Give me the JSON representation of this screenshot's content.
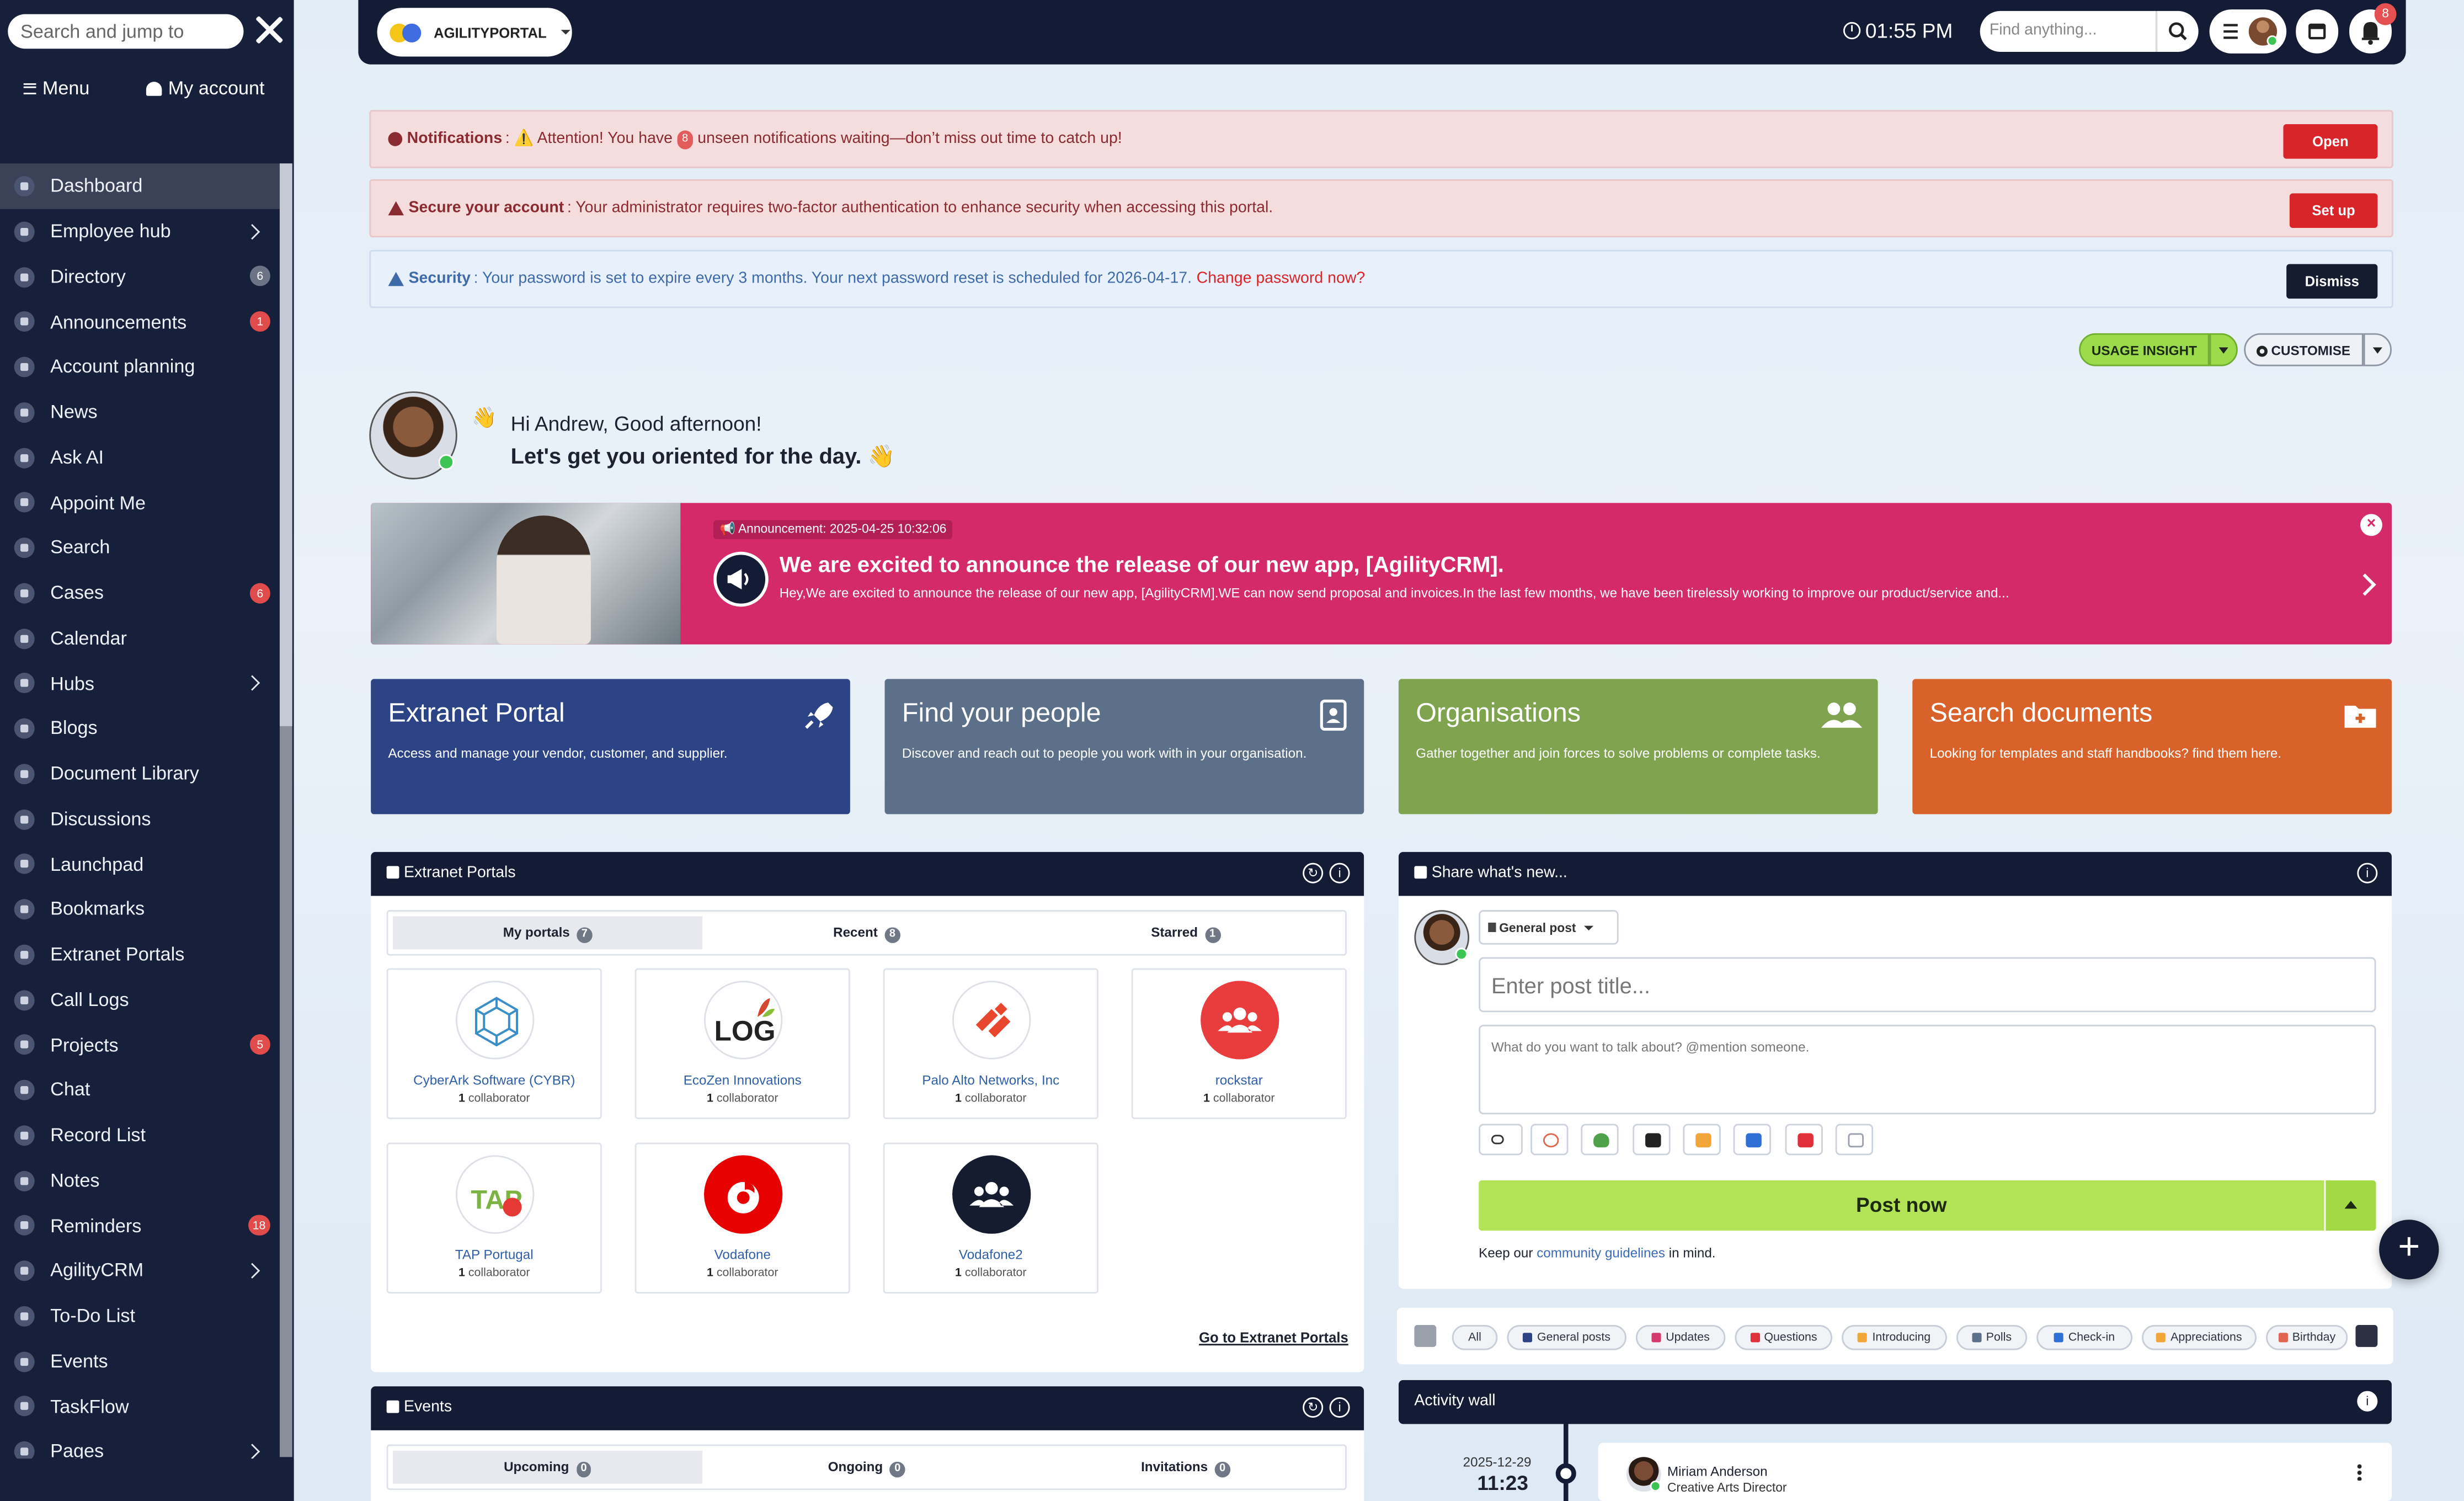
{
  "sidebar": {
    "search_placeholder": "Search and jump to",
    "menu_tab": "Menu",
    "account_tab": "My account",
    "items": [
      {
        "label": "Dashboard"
      },
      {
        "label": "Employee hub",
        "chevron": true
      },
      {
        "label": "Directory",
        "badge": "6",
        "badge_color": "gray"
      },
      {
        "label": "Announcements",
        "badge": "1",
        "badge_color": "red"
      },
      {
        "label": "Account planning"
      },
      {
        "label": "News"
      },
      {
        "label": "Ask AI"
      },
      {
        "label": "Appoint Me"
      },
      {
        "label": "Search"
      },
      {
        "label": "Cases",
        "badge": "6",
        "badge_color": "red"
      },
      {
        "label": "Calendar"
      },
      {
        "label": "Hubs",
        "chevron": true
      },
      {
        "label": "Blogs"
      },
      {
        "label": "Document Library"
      },
      {
        "label": "Discussions"
      },
      {
        "label": "Launchpad"
      },
      {
        "label": "Bookmarks"
      },
      {
        "label": "Extranet Portals"
      },
      {
        "label": "Call Logs"
      },
      {
        "label": "Projects",
        "badge": "5",
        "badge_color": "red"
      },
      {
        "label": "Chat"
      },
      {
        "label": "Record List"
      },
      {
        "label": "Notes"
      },
      {
        "label": "Reminders",
        "badge": "18",
        "badge_color": "red"
      },
      {
        "label": "AgilityCRM",
        "chevron": true
      },
      {
        "label": "To-Do List"
      },
      {
        "label": "Events"
      },
      {
        "label": "TaskFlow"
      },
      {
        "label": "Pages",
        "chevron": true
      }
    ]
  },
  "topbar": {
    "brand": "AGILITYPORTAL",
    "time": "01:55 PM",
    "find_placeholder": "Find anything...",
    "notification_count": "8"
  },
  "alerts": {
    "notifications": {
      "title": "Notifications",
      "text_a": ": ⚠️ Attention! You have",
      "count": "8",
      "text_b": "unseen notifications waiting—don’t miss out time to catch up!",
      "button": "Open"
    },
    "secure": {
      "title": "Secure your account",
      "text": ": Your administrator requires two-factor authentication to enhance security when accessing this portal.",
      "button": "Set up"
    },
    "security": {
      "title": "Security",
      "text": ": Your password is set to expire every 3 months. Your next password reset is scheduled for 2026-04-17.",
      "link": "Change password now?",
      "button": "Dismiss"
    }
  },
  "controls": {
    "usage": "USAGE INSIGHT",
    "customise": "CUSTOMISE"
  },
  "greeting": {
    "line1": "Hi Andrew, Good afternoon!",
    "line2": "Let's get you oriented for the day."
  },
  "announcement": {
    "tag": "Announcement: 2025-04-25 10:32:06",
    "title": "We are excited to announce the release of our new app, [AgilityCRM].",
    "body": "Hey,We are excited to announce the release of our new app, [AgilityCRM].WE can now send proposal and invoices.In the last few months, we have been tirelessly working to improve our product/service and..."
  },
  "tiles": [
    {
      "title": "Extranet Portal",
      "desc": "Access and manage your vendor, customer, and supplier.",
      "color": "#2c4486",
      "icon": "rocket-icon"
    },
    {
      "title": "Find your people",
      "desc": "Discover and reach out to people you work with in your organisation.",
      "color": "#5d7089",
      "icon": "contact-book-icon"
    },
    {
      "title": "Organisations",
      "desc": "Gather together and join forces to solve problems or complete tasks.",
      "color": "#7fa34f",
      "icon": "users-icon"
    },
    {
      "title": "Search documents",
      "desc": "Looking for templates and staff handbooks? find them here.",
      "color": "#d9622b",
      "icon": "folder-plus-icon"
    }
  ],
  "extranet": {
    "title": "Extranet Portals",
    "tabs": [
      {
        "label": "My portals",
        "count": "7"
      },
      {
        "label": "Recent",
        "count": "8"
      },
      {
        "label": "Starred",
        "count": "1"
      }
    ],
    "portals": [
      {
        "name": "CyberArk Software (CYBR)",
        "count": "1",
        "unit": "collaborator"
      },
      {
        "name": "EcoZen Innovations",
        "count": "1",
        "unit": "collaborator"
      },
      {
        "name": "Palo Alto Networks, Inc",
        "count": "1",
        "unit": "collaborator"
      },
      {
        "name": "rockstar",
        "count": "1",
        "unit": "collaborator"
      },
      {
        "name": "TAP Portugal",
        "count": "1",
        "unit": "collaborator"
      },
      {
        "name": "Vodafone",
        "count": "1",
        "unit": "collaborator"
      },
      {
        "name": "Vodafone2",
        "count": "1",
        "unit": "collaborator"
      }
    ],
    "logo_texts": {
      "ecozen": "LOG",
      "tap": "TAP"
    },
    "goto": "Go to Extranet Portals"
  },
  "events": {
    "title": "Events",
    "tabs": [
      {
        "label": "Upcoming",
        "count": "0"
      },
      {
        "label": "Ongoing",
        "count": "0"
      },
      {
        "label": "Invitations",
        "count": "0"
      }
    ]
  },
  "share": {
    "title": "Share what's new...",
    "post_type": "General post",
    "title_placeholder": "Enter post title...",
    "body_placeholder": "What do you want to talk about? @mention someone.",
    "post_button": "Post now",
    "keep_a": "Keep our",
    "keep_link": "community guidelines",
    "keep_b": "in mind."
  },
  "filters": [
    "All",
    "General posts",
    "Updates",
    "Questions",
    "Introducing",
    "Polls",
    "Check-in",
    "Appreciations",
    "Birthday"
  ],
  "activity": {
    "title": "Activity wall",
    "date": "2025-12-29",
    "time": "11:23",
    "name": "Miriam Anderson",
    "role": "Creative Arts Director"
  }
}
